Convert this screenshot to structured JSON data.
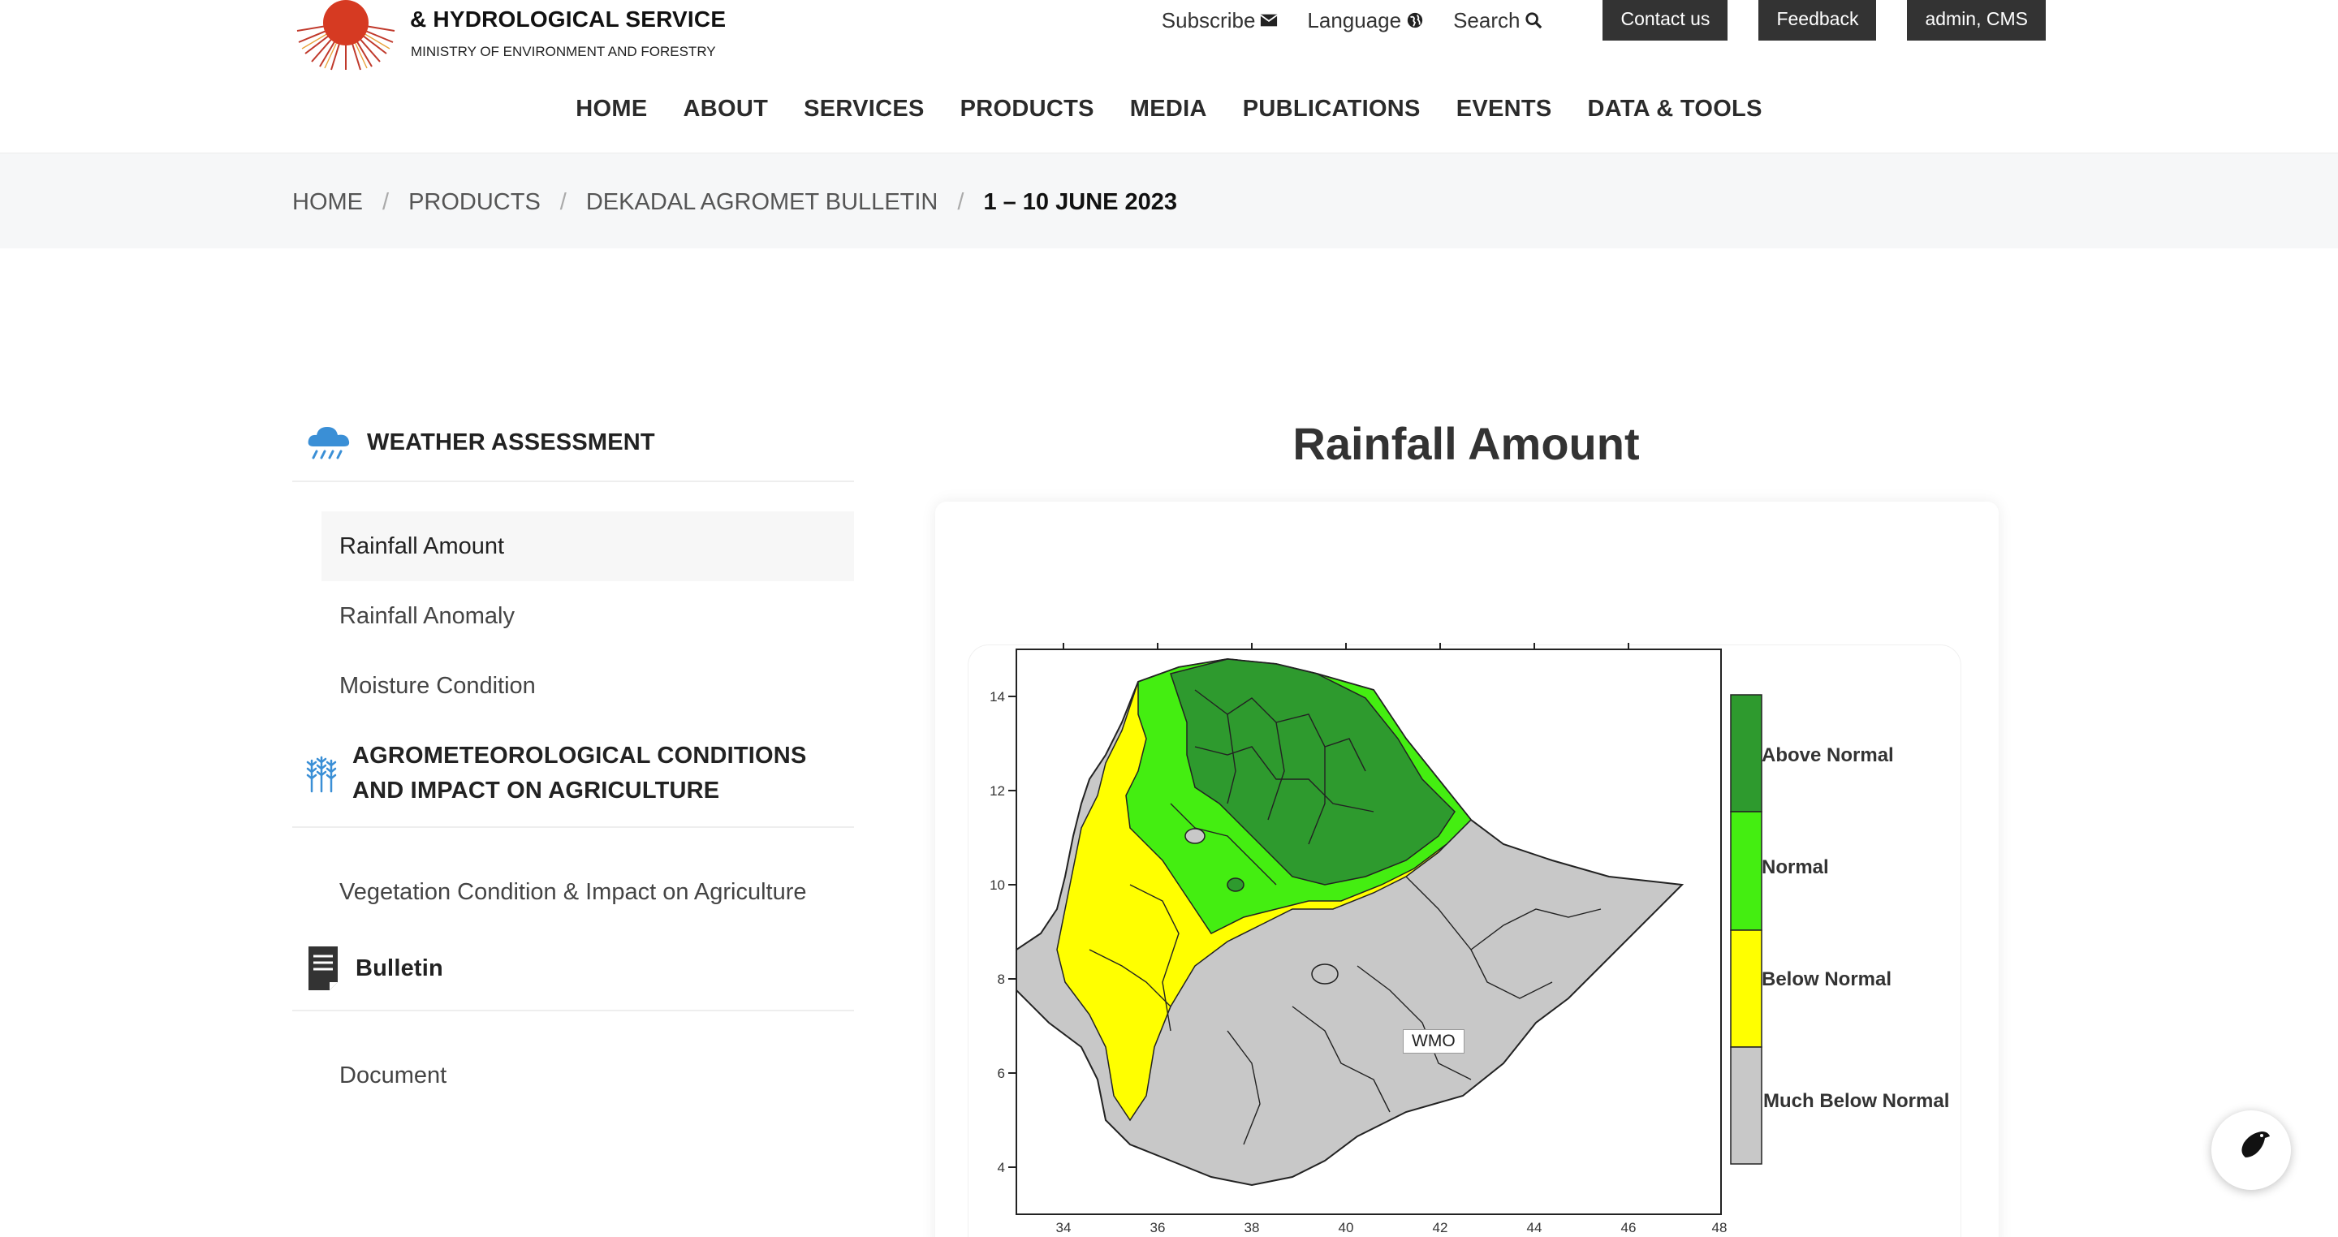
{
  "header": {
    "org_title": "& HYDROLOGICAL SERVICE",
    "org_subtitle": "MINISTRY OF ENVIRONMENT AND FORESTRY",
    "utility": {
      "subscribe": "Subscribe",
      "language": "Language",
      "search": "Search",
      "contact": "Contact us",
      "feedback": "Feedback",
      "admin": "admin, CMS"
    },
    "nav": [
      "HOME",
      "ABOUT",
      "SERVICES",
      "PRODUCTS",
      "MEDIA",
      "PUBLICATIONS",
      "EVENTS",
      "DATA & TOOLS"
    ]
  },
  "breadcrumb": {
    "items": [
      "HOME",
      "PRODUCTS",
      "DEKADAL AGROMET BULLETIN"
    ],
    "current": "1 – 10 JUNE 2023",
    "separator": "/"
  },
  "sidebar": {
    "weather_heading": "WEATHER ASSESSMENT",
    "weather_items": [
      "Rainfall Amount",
      "Rainfall Anomaly",
      "Moisture Condition"
    ],
    "agro_heading": "AGROMETEOROLOGICAL CONDITIONS AND IMPACT ON AGRICULTURE",
    "agro_items": [
      "Vegetation Condition & Impact on Agriculture"
    ],
    "bulletin_heading": "Bulletin",
    "bulletin_items": [
      "Document"
    ]
  },
  "content": {
    "title": "Rainfall Amount",
    "map": {
      "y_ticks": [
        "14",
        "12",
        "10",
        "8",
        "6",
        "4"
      ],
      "x_ticks": [
        "34",
        "36",
        "38",
        "40",
        "42",
        "44",
        "46",
        "48"
      ],
      "legend": [
        "Above Normal",
        "Normal",
        "Below Normal",
        "Much Below Normal"
      ],
      "legend_colors": [
        "#2e9a2e",
        "#44ee11",
        "#ffff00",
        "#c8c8c8"
      ],
      "watermark": "WMO"
    }
  },
  "colors": {
    "button_dark": "#333333",
    "breadcrumb_bg": "#f6f7f8",
    "icon_blue": "#3a8fd6"
  }
}
